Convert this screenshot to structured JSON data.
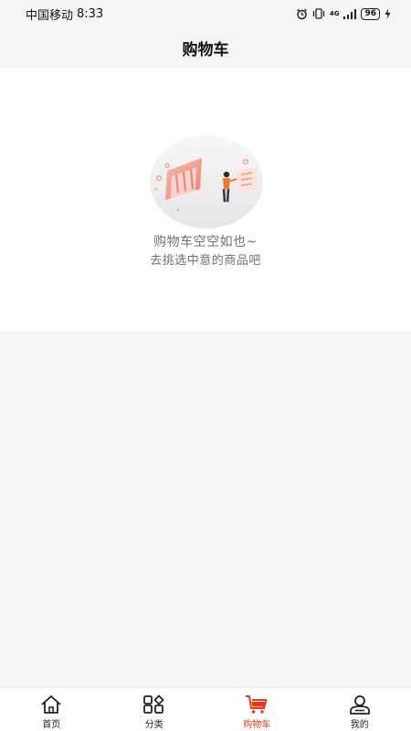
{
  "status_bar": {
    "carrier": "中国移动",
    "time": "8:33",
    "network": "4G",
    "battery": "96"
  },
  "header": {
    "title": "购物车"
  },
  "empty_state": {
    "title": "购物车空空如也~",
    "subtitle": "去挑选中意的商品吧"
  },
  "tabbar": {
    "tabs": [
      {
        "label": "首页",
        "icon": "home-icon",
        "active": false
      },
      {
        "label": "分类",
        "icon": "category-icon",
        "active": false
      },
      {
        "label": "购物车",
        "icon": "cart-icon",
        "active": true
      },
      {
        "label": "我的",
        "icon": "profile-icon",
        "active": false
      }
    ]
  },
  "colors": {
    "accent": "#e63a1e",
    "background": "#f5f5f5",
    "card": "#ffffff",
    "muted_text": "#707070"
  }
}
